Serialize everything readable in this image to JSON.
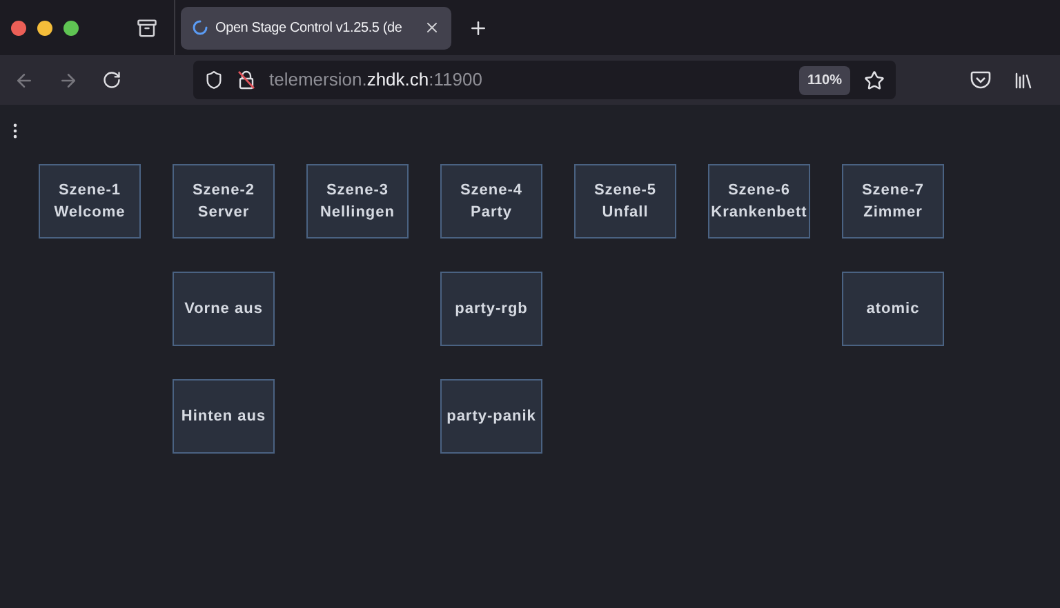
{
  "tab": {
    "title": "Open Stage Control v1.25.5 (de",
    "loading": true
  },
  "address_bar": {
    "url": "telemersion.**zhdk.ch**:11900",
    "zoom": "110%"
  },
  "grid": [
    [
      {
        "kind": "button",
        "lines": [
          "Szene-1",
          "Welcome"
        ]
      },
      {
        "kind": "button",
        "lines": [
          "Szene-2",
          "Server"
        ]
      },
      {
        "kind": "button",
        "lines": [
          "Szene-3",
          "Nellingen"
        ]
      },
      {
        "kind": "button",
        "lines": [
          "Szene-4",
          "Party"
        ]
      },
      {
        "kind": "button",
        "lines": [
          "Szene-5",
          "Unfall"
        ]
      },
      {
        "kind": "button",
        "lines": [
          "Szene-6",
          "Krankenbett"
        ]
      },
      {
        "kind": "button",
        "lines": [
          "Szene-7",
          "Zimmer"
        ]
      }
    ],
    [
      {
        "kind": "empty"
      },
      {
        "kind": "button",
        "lines": [
          "Vorne aus"
        ]
      },
      {
        "kind": "empty"
      },
      {
        "kind": "button",
        "lines": [
          "party-rgb"
        ]
      },
      {
        "kind": "empty"
      },
      {
        "kind": "empty"
      },
      {
        "kind": "button",
        "lines": [
          "atomic"
        ]
      }
    ],
    [
      {
        "kind": "empty"
      },
      {
        "kind": "button",
        "lines": [
          "Hinten aus"
        ]
      },
      {
        "kind": "empty"
      },
      {
        "kind": "button",
        "lines": [
          "party-panik"
        ]
      },
      {
        "kind": "empty"
      },
      {
        "kind": "empty"
      },
      {
        "kind": "empty"
      }
    ]
  ]
}
